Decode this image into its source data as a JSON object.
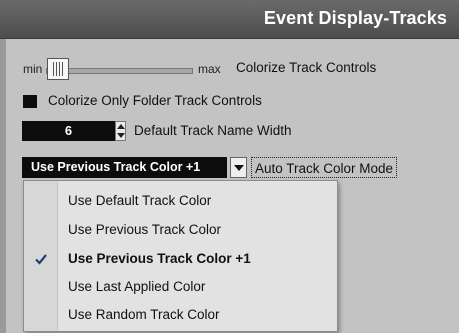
{
  "header": {
    "title": "Event Display-Tracks"
  },
  "colorize_track_controls": {
    "min_label": "min",
    "max_label": "max",
    "label": "Colorize Track Controls",
    "level": 0.0
  },
  "colorize_folder": {
    "label": "Colorize Only Folder Track Controls",
    "checked": false
  },
  "track_name_width": {
    "value": "6",
    "label": "Default Track Name Width"
  },
  "auto_color_mode": {
    "selected": "Use Previous Track Color +1",
    "label": "Auto Track Color Mode",
    "options": [
      "Use Default Track Color",
      "Use Previous Track Color",
      "Use Previous Track Color +1",
      "Use Last Applied Color",
      "Use Random Track Color"
    ],
    "selected_index": 2
  },
  "icons": [
    "slider-thumb-icon",
    "spin-up-icon",
    "spin-down-icon",
    "dropdown-arrow-icon",
    "check-icon"
  ]
}
